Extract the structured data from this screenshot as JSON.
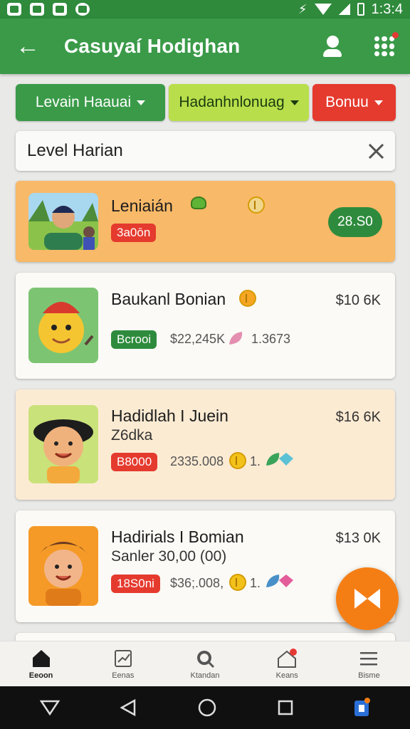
{
  "status_bar": {
    "time": "1:3:4"
  },
  "app_bar": {
    "title": "Casuyaí Hodighan"
  },
  "filters": [
    {
      "label": "Levain Haauai"
    },
    {
      "label": "Hadanhnlonuag"
    },
    {
      "label": "Bonuu"
    }
  ],
  "search": {
    "value": "Level Harian"
  },
  "cards": [
    {
      "name": "Leniaián",
      "badge": "3a0ōn",
      "price_pill": "28.S0"
    },
    {
      "name": "Baukanl Bonian",
      "badge": "Bcrooi",
      "price": "$10 6K",
      "amount": "$22,245K",
      "count": "1.3673"
    },
    {
      "name": "Hadidlah I Juein",
      "subtitle": "Z6dka",
      "badge": "B8000",
      "price": "$16 6K",
      "amount": "2335.008",
      "count": "1."
    },
    {
      "name": "Hadirials I Bomian",
      "subtitle": "Sanler 30,00 (00)",
      "badge": "18S0ni",
      "price": "$13 0K",
      "amount": "$36;.008,",
      "count": "1."
    }
  ],
  "bottom_nav": [
    {
      "label": "Eeoon"
    },
    {
      "label": "Eenas"
    },
    {
      "label": "Ktandan"
    },
    {
      "label": "Keans"
    },
    {
      "label": "Bisme"
    }
  ],
  "colors": {
    "primary": "#3a9a48",
    "lime": "#b8df4b",
    "red": "#e53a2e",
    "orange": "#f57e14",
    "card_highlight": "#f8b968"
  }
}
